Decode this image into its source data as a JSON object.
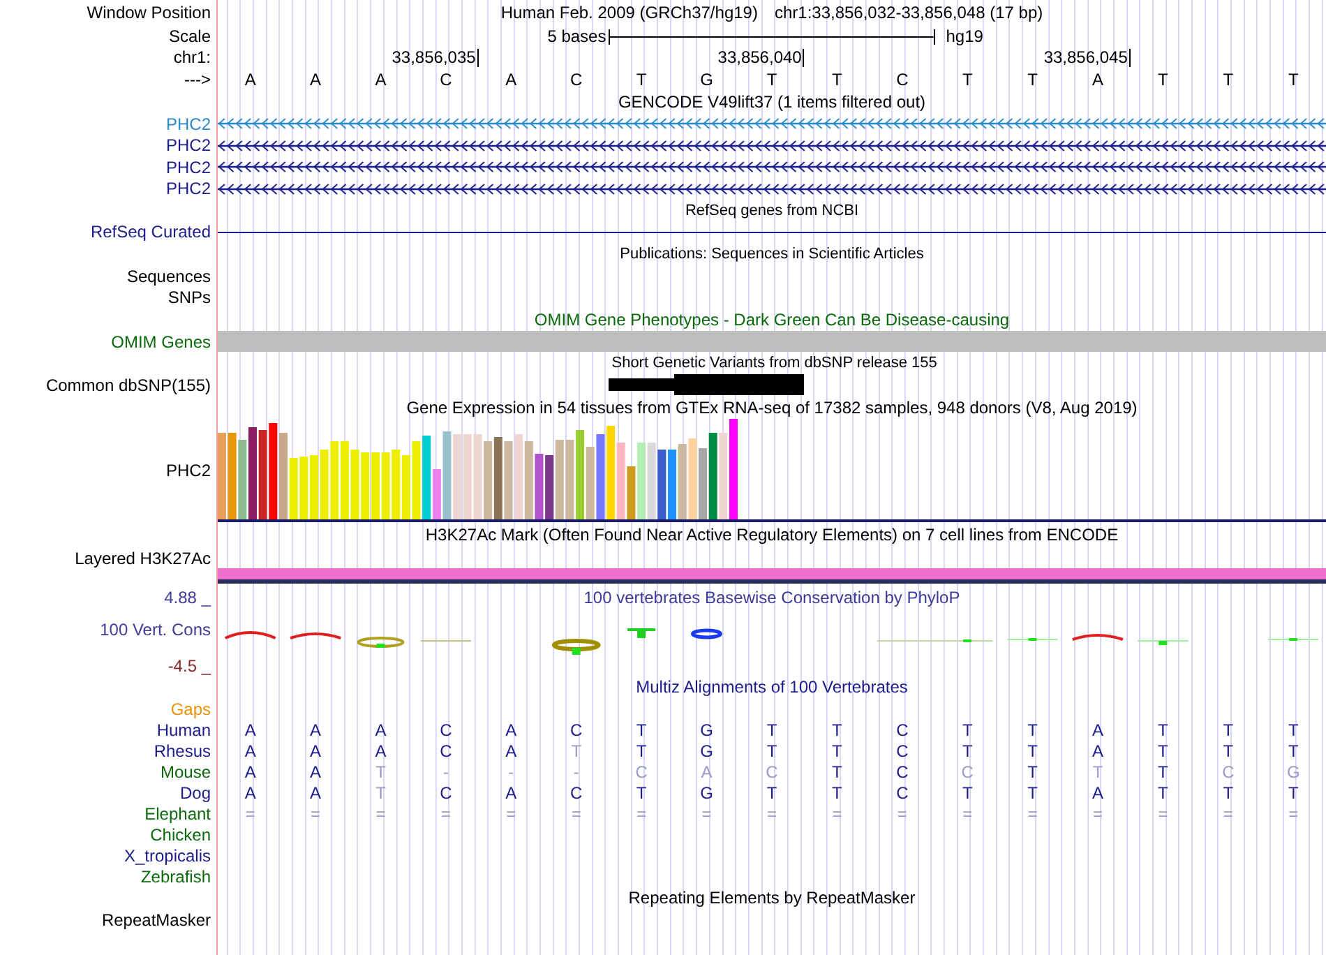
{
  "header": {
    "label": "Window Position",
    "assembly": "Human Feb. 2009 (GRCh37/hg19)",
    "range": "chr1:33,856,032-33,856,048 (17 bp)"
  },
  "scale": {
    "label": "Scale",
    "span": "5 bases",
    "db": "hg19"
  },
  "coordinates": {
    "label": "chr1:",
    "ticks": [
      "33,856,035",
      "33,856,040",
      "33,856,045"
    ]
  },
  "sequence": {
    "label": "--->",
    "bases": [
      "A",
      "A",
      "A",
      "C",
      "A",
      "C",
      "T",
      "G",
      "T",
      "T",
      "C",
      "T",
      "T",
      "A",
      "T",
      "T",
      "T"
    ]
  },
  "gencode": {
    "title": "GENCODE V49lift37 (1 items filtered out)",
    "items": [
      {
        "name": "PHC2",
        "color": "#2a8ac8"
      },
      {
        "name": "PHC2",
        "color": "#1c1c8c"
      },
      {
        "name": "PHC2",
        "color": "#1c1c8c"
      },
      {
        "name": "PHC2",
        "color": "#1c1c8c"
      }
    ]
  },
  "refseq": {
    "title": "RefSeq genes from NCBI",
    "label": "RefSeq Curated"
  },
  "publications": {
    "title": "Publications: Sequences in Scientific Articles",
    "labels": [
      "Sequences",
      "SNPs"
    ]
  },
  "omim": {
    "title": "OMIM Gene Phenotypes - Dark Green Can Be Disease-causing",
    "label": "OMIM Genes"
  },
  "dbsnp": {
    "title": "Short Genetic Variants from dbSNP release 155",
    "label": "Common dbSNP(155)"
  },
  "gtex": {
    "title": "Gene Expression in 54 tissues from GTEx RNA-seq of 17382 samples, 948 donors (V8, Aug 2019)",
    "label": "PHC2"
  },
  "h3k27ac": {
    "title": "H3K27Ac Mark (Often Found Near Active Regulatory Elements) on 7 cell lines from ENCODE",
    "label": "Layered H3K27Ac"
  },
  "phylop": {
    "title": "100 vertebrates Basewise Conservation by PhyloP",
    "label": "100 Vert. Cons",
    "max": "4.88 _",
    "min": "-4.5 _"
  },
  "multiz": {
    "title": "Multiz Alignments of 100 Vertebrates",
    "species": [
      {
        "name": "Gaps",
        "color": "#f0900a"
      },
      {
        "name": "Human",
        "color": "#1c1c8c",
        "bases": [
          "A",
          "A",
          "A",
          "C",
          "A",
          "C",
          "T",
          "G",
          "T",
          "T",
          "C",
          "T",
          "T",
          "A",
          "T",
          "T",
          "T"
        ],
        "faded": [
          false,
          false,
          false,
          false,
          false,
          false,
          false,
          false,
          false,
          false,
          false,
          false,
          false,
          false,
          false,
          false,
          false
        ]
      },
      {
        "name": "Rhesus",
        "color": "#1c1c8c",
        "bases": [
          "A",
          "A",
          "A",
          "C",
          "A",
          "T",
          "T",
          "G",
          "T",
          "T",
          "C",
          "T",
          "T",
          "A",
          "T",
          "T",
          "T"
        ],
        "faded": [
          false,
          false,
          false,
          false,
          false,
          true,
          false,
          false,
          false,
          false,
          false,
          false,
          false,
          false,
          false,
          false,
          false
        ]
      },
      {
        "name": "Mouse",
        "color": "#0a6a0a",
        "bases": [
          "A",
          "A",
          "T",
          "-",
          "-",
          "-",
          "C",
          "A",
          "C",
          "T",
          "C",
          "C",
          "T",
          "T",
          "T",
          "C",
          "G"
        ],
        "faded": [
          false,
          false,
          true,
          true,
          true,
          true,
          true,
          true,
          true,
          false,
          false,
          true,
          false,
          true,
          false,
          true,
          true
        ]
      },
      {
        "name": "Dog",
        "color": "#1c1c8c",
        "bases": [
          "A",
          "A",
          "T",
          "C",
          "A",
          "C",
          "T",
          "G",
          "T",
          "T",
          "C",
          "T",
          "T",
          "A",
          "T",
          "T",
          "T"
        ],
        "faded": [
          false,
          false,
          true,
          false,
          false,
          false,
          false,
          false,
          false,
          false,
          false,
          false,
          false,
          false,
          false,
          false,
          false
        ]
      },
      {
        "name": "Elephant",
        "color": "#0a6a0a",
        "bases": [
          "=",
          "=",
          "=",
          "=",
          "=",
          "=",
          "=",
          "=",
          "=",
          "=",
          "=",
          "=",
          "=",
          "=",
          "=",
          "=",
          "="
        ],
        "faded": [
          true,
          true,
          true,
          true,
          true,
          true,
          true,
          true,
          true,
          true,
          true,
          true,
          true,
          true,
          true,
          true,
          true
        ]
      },
      {
        "name": "Chicken",
        "color": "#0a6a0a"
      },
      {
        "name": "X_tropicalis",
        "color": "#1c1c8c"
      },
      {
        "name": "Zebrafish",
        "color": "#0a6a0a"
      }
    ]
  },
  "repeatmasker": {
    "title": "Repeating Elements by RepeatMasker",
    "label": "RepeatMasker"
  }
}
